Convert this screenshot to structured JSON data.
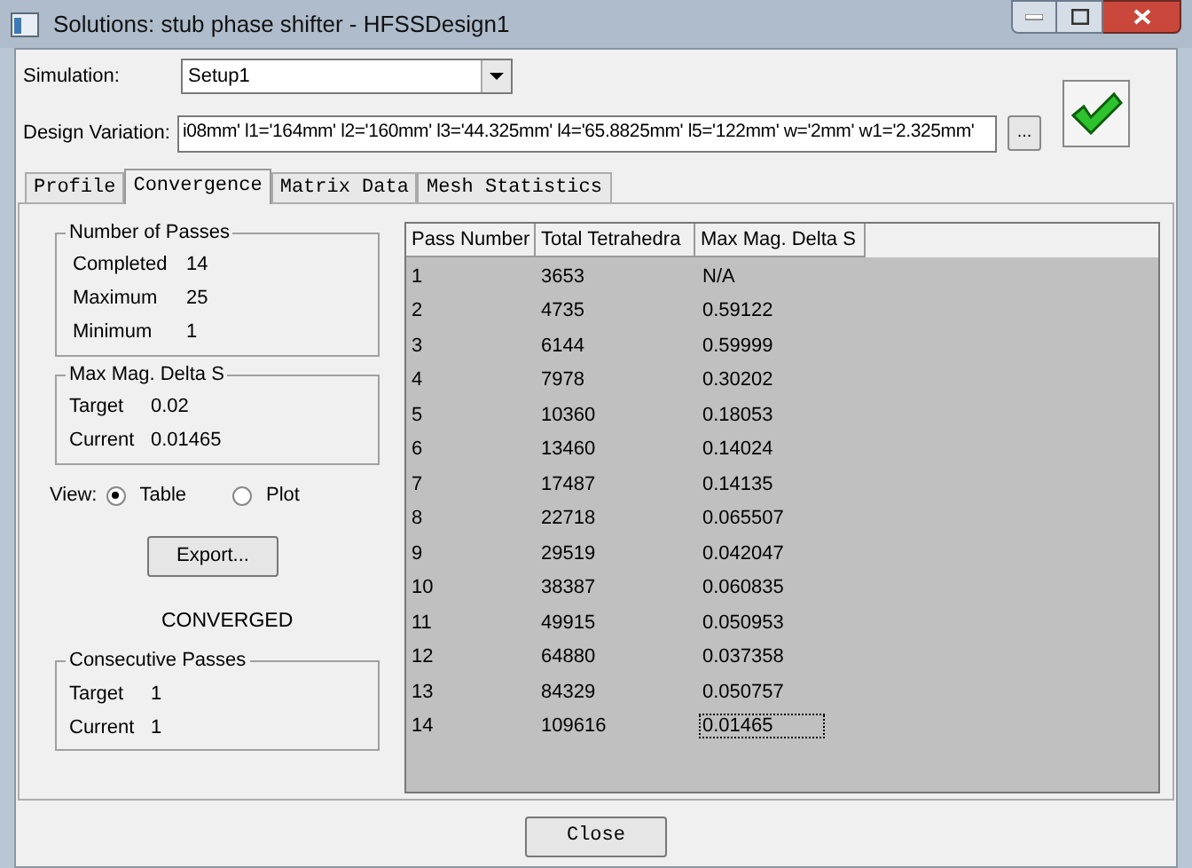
{
  "window": {
    "title": "Solutions: stub phase shifter - HFSSDesign1"
  },
  "simulation": {
    "label": "Simulation:",
    "value": "Setup1"
  },
  "design_variation": {
    "label": "Design Variation:",
    "value": "i08mm' l1='164mm' l2='160mm' l3='44.325mm' l4='65.8825mm' l5='122mm' w='2mm' w1='2.325mm'",
    "button": "..."
  },
  "tabs": [
    {
      "label": "Profile",
      "selected": false
    },
    {
      "label": "Convergence",
      "selected": true
    },
    {
      "label": "Matrix Data",
      "selected": false
    },
    {
      "label": "Mesh Statistics",
      "selected": false
    }
  ],
  "groups": [
    {
      "title": "Number of Passes",
      "rows": [
        {
          "label": "Completed",
          "value": "14"
        },
        {
          "label": "Maximum",
          "value": "25"
        },
        {
          "label": "Minimum",
          "value": "1"
        }
      ]
    },
    {
      "title": "Max Mag. Delta S",
      "rows": [
        {
          "label": "Target",
          "value": "0.02"
        },
        {
          "label": "Current",
          "value": "0.01465"
        }
      ]
    }
  ],
  "view": {
    "label": "View:",
    "options": [
      {
        "label": "Table",
        "selected": true
      },
      {
        "label": "Plot",
        "selected": false
      }
    ]
  },
  "export_button": "Export...",
  "status": "CONVERGED",
  "consecutive": {
    "title": "Consecutive Passes",
    "rows": [
      {
        "label": "Target",
        "value": "1"
      },
      {
        "label": "Current",
        "value": "1"
      }
    ]
  },
  "table": {
    "columns": [
      "Pass Number",
      "Total Tetrahedra",
      "Max Mag. Delta S"
    ],
    "rows": [
      {
        "cells": [
          "1",
          "3653",
          "N/A"
        ],
        "focused": false
      },
      {
        "cells": [
          "2",
          "4735",
          "0.59122"
        ],
        "focused": false
      },
      {
        "cells": [
          "3",
          "6144",
          "0.59999"
        ],
        "focused": false
      },
      {
        "cells": [
          "4",
          "7978",
          "0.30202"
        ],
        "focused": false
      },
      {
        "cells": [
          "5",
          "10360",
          "0.18053"
        ],
        "focused": false
      },
      {
        "cells": [
          "6",
          "13460",
          "0.14024"
        ],
        "focused": false
      },
      {
        "cells": [
          "7",
          "17487",
          "0.14135"
        ],
        "focused": false
      },
      {
        "cells": [
          "8",
          "22718",
          "0.065507"
        ],
        "focused": false
      },
      {
        "cells": [
          "9",
          "29519",
          "0.042047"
        ],
        "focused": false
      },
      {
        "cells": [
          "10",
          "38387",
          "0.060835"
        ],
        "focused": false
      },
      {
        "cells": [
          "11",
          "49915",
          "0.050953"
        ],
        "focused": false
      },
      {
        "cells": [
          "12",
          "64880",
          "0.037358"
        ],
        "focused": false
      },
      {
        "cells": [
          "13",
          "84329",
          "0.050757"
        ],
        "focused": false
      },
      {
        "cells": [
          "14",
          "109616",
          "0.01465"
        ],
        "focused": true
      }
    ]
  },
  "close_button": "Close"
}
